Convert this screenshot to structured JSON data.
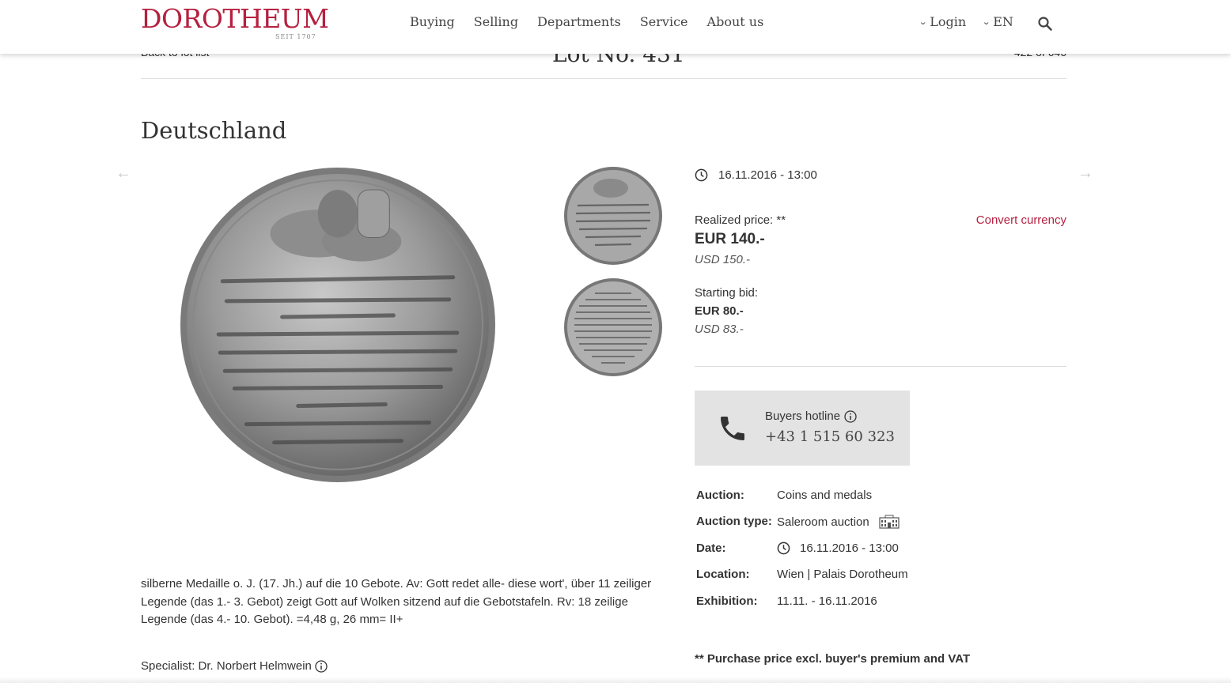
{
  "brand": {
    "name": "DOROTHEUM",
    "tagline": "SEIT 1707",
    "color": "#b5203f"
  },
  "nav": {
    "items": [
      "Buying",
      "Selling",
      "Departments",
      "Service",
      "About us"
    ]
  },
  "header": {
    "login_label": "Login",
    "language_label": "EN",
    "search_icon": "search-icon"
  },
  "lotbar": {
    "back_label": "Back to lot list",
    "lot_title": "Lot No. 431",
    "lot_count": "422 of 646"
  },
  "lot": {
    "title": "Deutschland",
    "datetime": "16.11.2016 - 13:00",
    "realized_label": "Realized price: **",
    "realized_eur": "EUR 140.-",
    "realized_usd": "USD 150.-",
    "convert_label": "Convert currency",
    "starting_label": "Starting bid:",
    "starting_eur": "EUR 80.-",
    "starting_usd": "USD 83.-"
  },
  "hotline": {
    "label": "Buyers hotline",
    "number": "+43 1 515 60 323",
    "icon": "phone-icon"
  },
  "facts": [
    {
      "key": "Auction:",
      "value": "Coins and medals"
    },
    {
      "key": "Auction type:",
      "value": "Saleroom auction"
    },
    {
      "key": "Date:",
      "value": "16.11.2016 - 13:00"
    },
    {
      "key": "Location:",
      "value": "Wien | Palais Dorotheum"
    },
    {
      "key": "Exhibition:",
      "value": "11.11. - 16.11.2016"
    }
  ],
  "description": "silberne Medaille o. J. (17. Jh.) auf die 10 Gebote. Av: Gott redet alle- diese wort', über 11 zeiliger Legende (das 1.- 3. Gebot) zeigt Gott auf Wolken sitzend auf die Gebotstafeln. Rv: 18 zeilige Legende (das 4.- 10. Gebot). =4,48 g, 26 mm= II+",
  "specialist": "Specialist: Dr. Norbert Helmwein",
  "footnote": "** Purchase price excl. buyer's premium and VAT"
}
